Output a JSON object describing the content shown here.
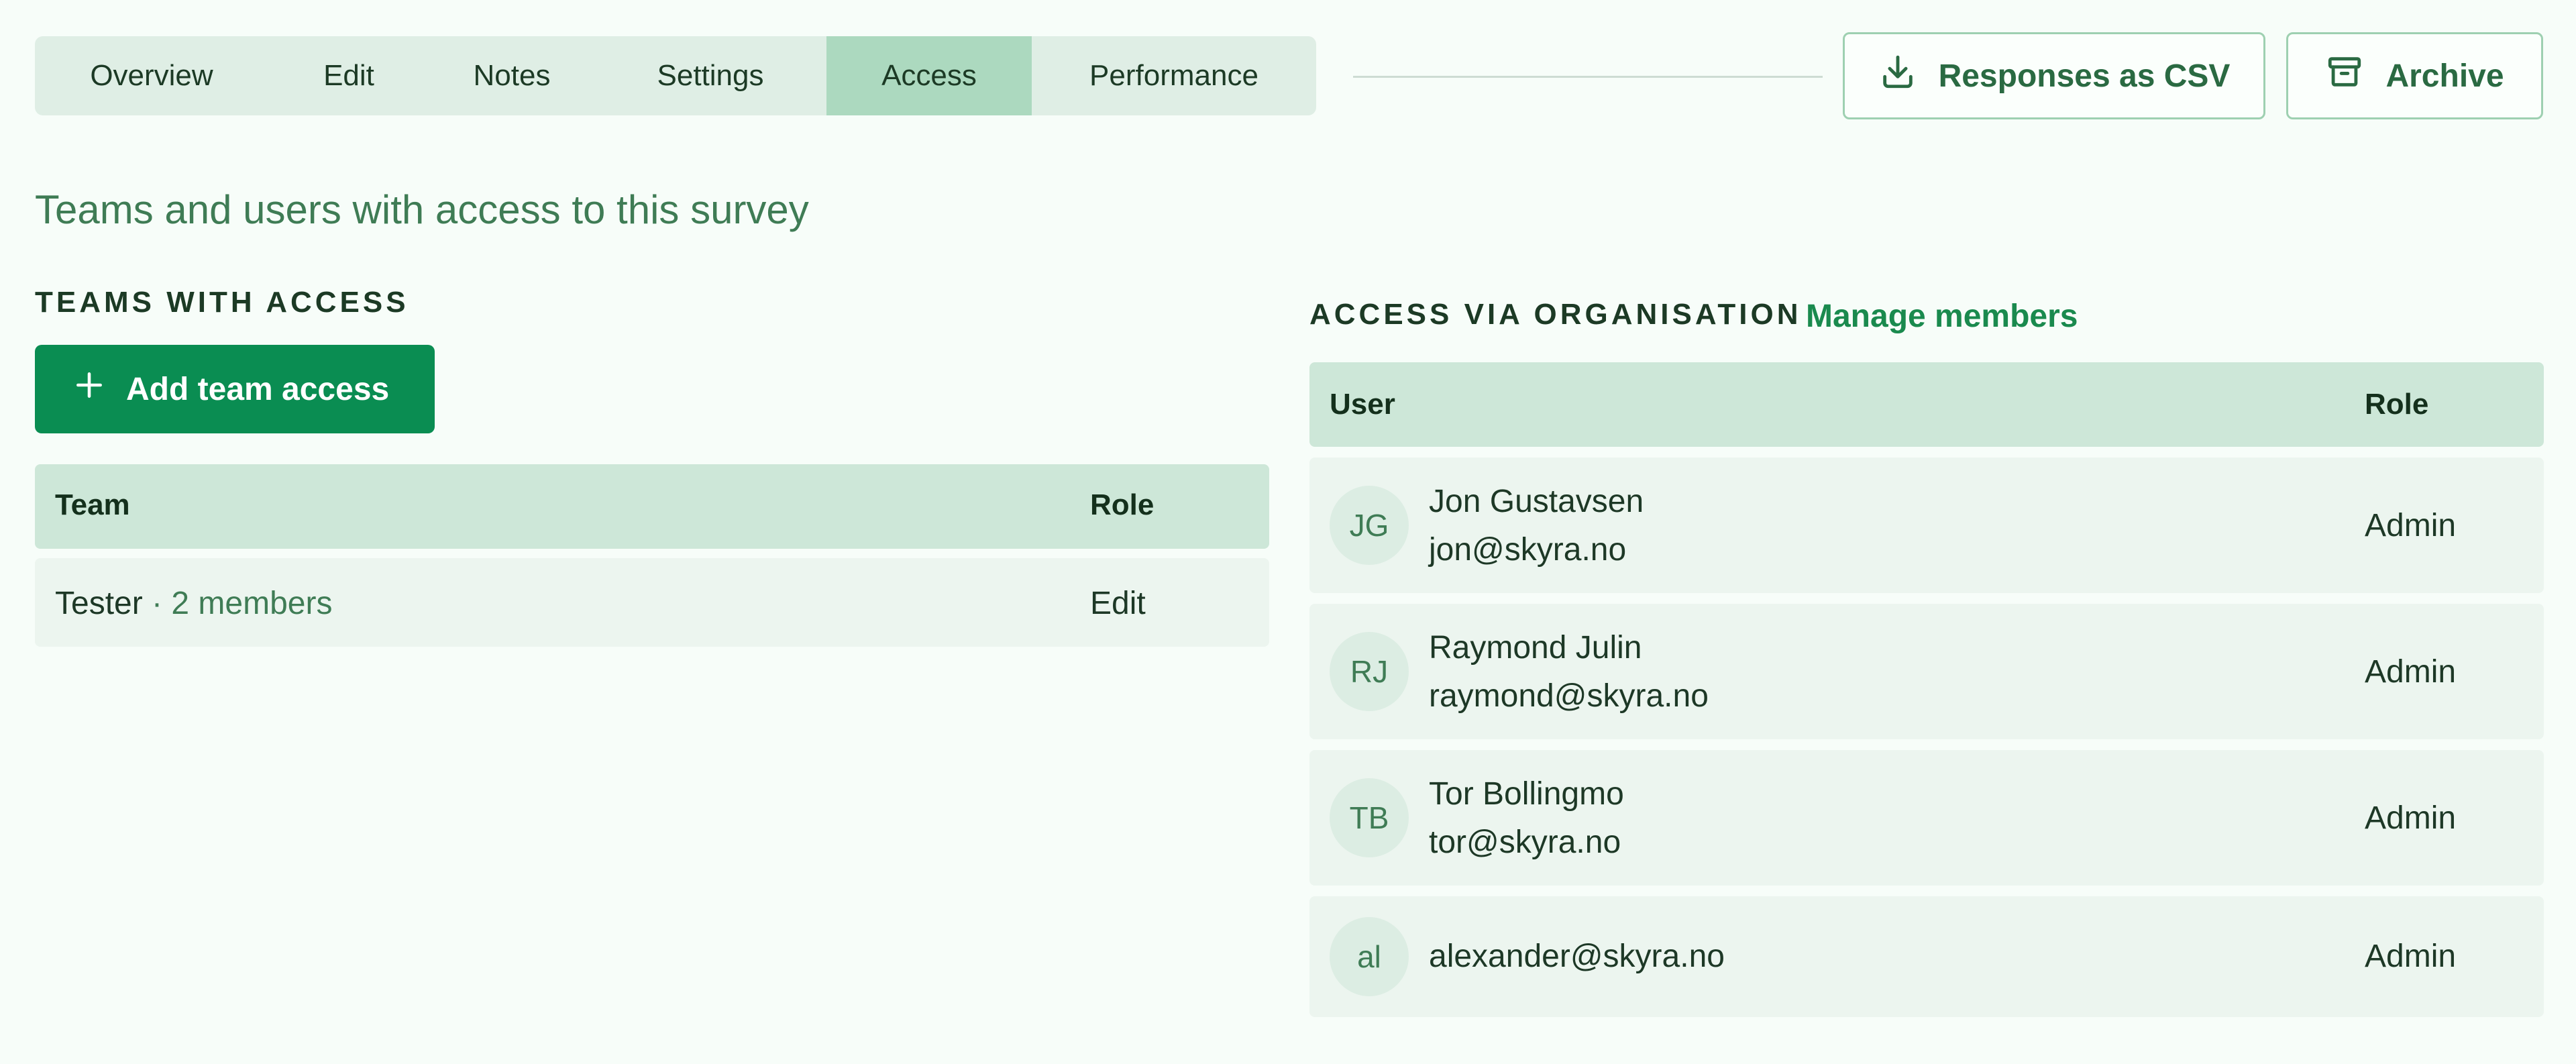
{
  "tabs": [
    {
      "label": "Overview"
    },
    {
      "label": "Edit"
    },
    {
      "label": "Notes"
    },
    {
      "label": "Settings"
    },
    {
      "label": "Access"
    },
    {
      "label": "Performance"
    }
  ],
  "active_tab": "Access",
  "actions": {
    "csv_label": "Responses as CSV",
    "archive_label": "Archive"
  },
  "page_heading": "Teams and users with access to this survey",
  "teams": {
    "section_label": "TEAMS WITH ACCESS",
    "add_button_label": "Add team access",
    "header": {
      "team": "Team",
      "role": "Role"
    },
    "rows": [
      {
        "name": "Tester",
        "members": " · 2 members",
        "role": "Edit"
      }
    ]
  },
  "org": {
    "section_label": "ACCESS VIA ORGANISATION",
    "manage_link": "Manage members",
    "header": {
      "user": "User",
      "role": "Role"
    },
    "users": [
      {
        "initials": "JG",
        "name": "Jon Gustavsen",
        "email": "jon@skyra.no",
        "role": "Admin"
      },
      {
        "initials": "RJ",
        "name": "Raymond Julin",
        "email": "raymond@skyra.no",
        "role": "Admin"
      },
      {
        "initials": "TB",
        "name": "Tor Bollingmo",
        "email": "tor@skyra.no",
        "role": "Admin"
      },
      {
        "initials": "al",
        "name": "",
        "email": "alexander@skyra.no",
        "role": "Admin"
      }
    ]
  },
  "colors": {
    "accent": "#0a8d52",
    "active_tab": "#acd9bf",
    "table_header": "#cde7d8",
    "row_bg": "#ecf5ef"
  }
}
